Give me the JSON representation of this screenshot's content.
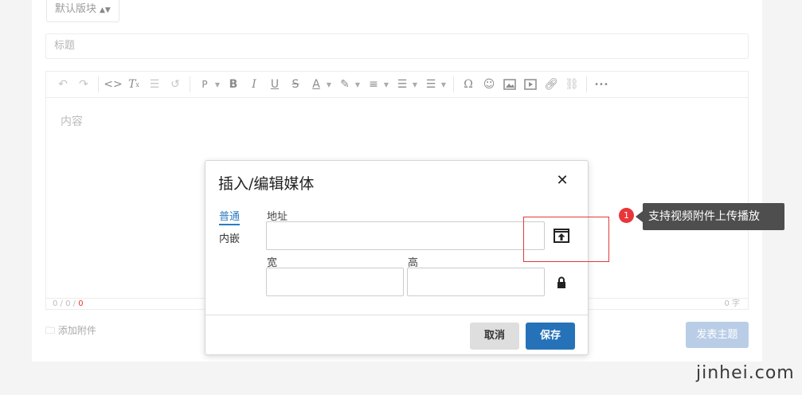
{
  "form": {
    "block_select": "默认版块",
    "title_placeholder": "标题",
    "content_placeholder": "内容",
    "status_path": "0 / 0 / ",
    "status_path_red": "0",
    "word_count": "0 字",
    "attach_label": "添加附件",
    "publish_label": "发表主题"
  },
  "toolbar": {
    "icons": [
      "undo-icon",
      "redo-icon",
      "code-icon",
      "clear-format-icon",
      "list-icon",
      "history-icon",
      "paragraph-icon",
      "bold-icon",
      "italic-icon",
      "underline-icon",
      "strikethrough-icon",
      "font-color-icon",
      "highlight-icon",
      "align-icon",
      "bullet-list-icon",
      "numbered-list-icon",
      "omega-icon",
      "emoji-icon",
      "image-icon",
      "media-icon",
      "link-icon",
      "unlink-icon",
      "more-icon"
    ],
    "paragraph": "P",
    "bold": "B",
    "italic": "I",
    "underline": "U",
    "strike": "S",
    "font_color": "A",
    "omega": "Ω",
    "more": "•••"
  },
  "dialog": {
    "title": "插入/编辑媒体",
    "tabs": [
      {
        "label": "普通"
      },
      {
        "label": "内嵌"
      }
    ],
    "address_label": "地址",
    "address_value": "",
    "width_label": "宽",
    "width_value": "",
    "height_label": "高",
    "height_value": "",
    "cancel_label": "取消",
    "save_label": "保存"
  },
  "annotation": {
    "badge": "1",
    "text": "支持视频附件上传播放",
    "highlight_color": "#e03a3a"
  },
  "watermark": "jinhei.com",
  "colors": {
    "accent": "#2672b9",
    "publish_disabled": "#b9cde6",
    "badge": "#e8363a"
  }
}
